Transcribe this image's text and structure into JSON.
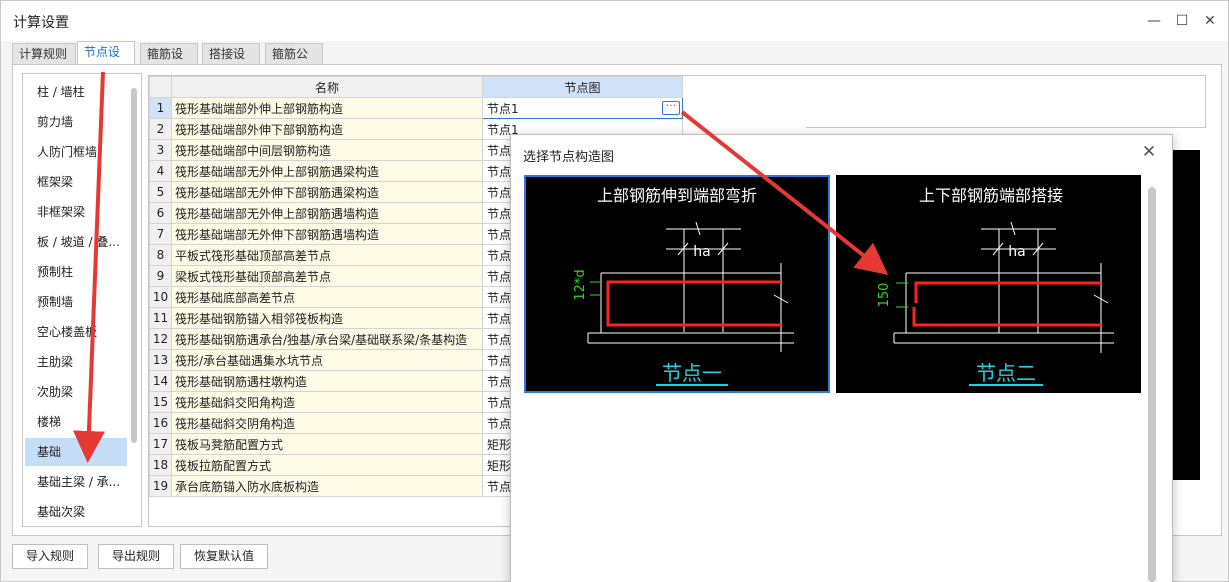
{
  "window": {
    "title": "计算设置",
    "minimize_glyph": "—",
    "maximize_glyph": "☐",
    "close_glyph": "✕"
  },
  "tabs": [
    {
      "label": "计算规则",
      "active": false
    },
    {
      "label": "节点设置",
      "active": true
    },
    {
      "label": "箍筋设置",
      "active": false
    },
    {
      "label": "搭接设置",
      "active": false
    },
    {
      "label": "箍筋公式",
      "active": false
    }
  ],
  "sidebar": {
    "items": [
      "柱 / 墙柱",
      "剪力墙",
      "人防门框墙",
      "框架梁",
      "非框架梁",
      "板 / 坡道 / 叠...",
      "预制柱",
      "预制墙",
      "空心楼盖板",
      "主肋梁",
      "次肋梁",
      "楼梯",
      "基础",
      "基础主梁 / 承...",
      "基础次梁"
    ],
    "selected_index": 12
  },
  "table": {
    "headers": {
      "name": "名称",
      "node": "节点图"
    },
    "rows": [
      {
        "num": "1",
        "name": "筏形基础端部外伸上部钢筋构造",
        "node": "节点1"
      },
      {
        "num": "2",
        "name": "筏形基础端部外伸下部钢筋构造",
        "node": "节点1"
      },
      {
        "num": "3",
        "name": "筏形基础端部中间层钢筋构造",
        "node": "节点"
      },
      {
        "num": "4",
        "name": "筏形基础端部无外伸上部钢筋遇梁构造",
        "node": "节点"
      },
      {
        "num": "5",
        "name": "筏形基础端部无外伸下部钢筋遇梁构造",
        "node": "节点"
      },
      {
        "num": "6",
        "name": "筏形基础端部无外伸上部钢筋遇墙构造",
        "node": "节点"
      },
      {
        "num": "7",
        "name": "筏形基础端部无外伸下部钢筋遇墙构造",
        "node": "节点"
      },
      {
        "num": "8",
        "name": "平板式筏形基础顶部高差节点",
        "node": "节点"
      },
      {
        "num": "9",
        "name": "梁板式筏形基础顶部高差节点",
        "node": "节点"
      },
      {
        "num": "10",
        "name": "筏形基础底部高差节点",
        "node": "节点"
      },
      {
        "num": "11",
        "name": "筏形基础钢筋锚入相邻筏板构造",
        "node": "节点"
      },
      {
        "num": "12",
        "name": "筏形基础钢筋遇承台/独基/承台梁/基础联系梁/条基构造",
        "node": "节点"
      },
      {
        "num": "13",
        "name": "筏形/承台基础遇集水坑节点",
        "node": "节点"
      },
      {
        "num": "14",
        "name": "筏形基础钢筋遇柱墩构造",
        "node": "节点"
      },
      {
        "num": "15",
        "name": "筏形基础斜交阳角构造",
        "node": "节点"
      },
      {
        "num": "16",
        "name": "筏形基础斜交阴角构造",
        "node": "节点"
      },
      {
        "num": "17",
        "name": "筏板马凳筋配置方式",
        "node": "矩形"
      },
      {
        "num": "18",
        "name": "筏板拉筋配置方式",
        "node": "矩形"
      },
      {
        "num": "19",
        "name": "承台底筋锚入防水底板构造",
        "node": "节点"
      }
    ],
    "current_row": 0,
    "dots_label": "···"
  },
  "buttons": {
    "import": "导入规则",
    "export": "导出规则",
    "reset": "恢复默认值"
  },
  "dialog": {
    "title": "选择节点构造图",
    "close_glyph": "✕",
    "options": [
      {
        "title": "上部钢筋伸到端部弯折",
        "caption": "节点一",
        "dim_label": "12*d",
        "ha_label": "ha",
        "selected": true
      },
      {
        "title": "上下部钢筋端部搭接",
        "caption": "节点二",
        "dim_label": "150",
        "ha_label": "ha",
        "selected": false
      }
    ]
  },
  "colors": {
    "accent": "#2b7cd8",
    "selected_row": "#c5ddf7",
    "name_cell_bg": "#fdfbe6",
    "annotation_arrow": "#e53935",
    "rebar": "#ff2020",
    "dim_green": "#22dd22",
    "caption_cyan": "#19d3e0"
  }
}
